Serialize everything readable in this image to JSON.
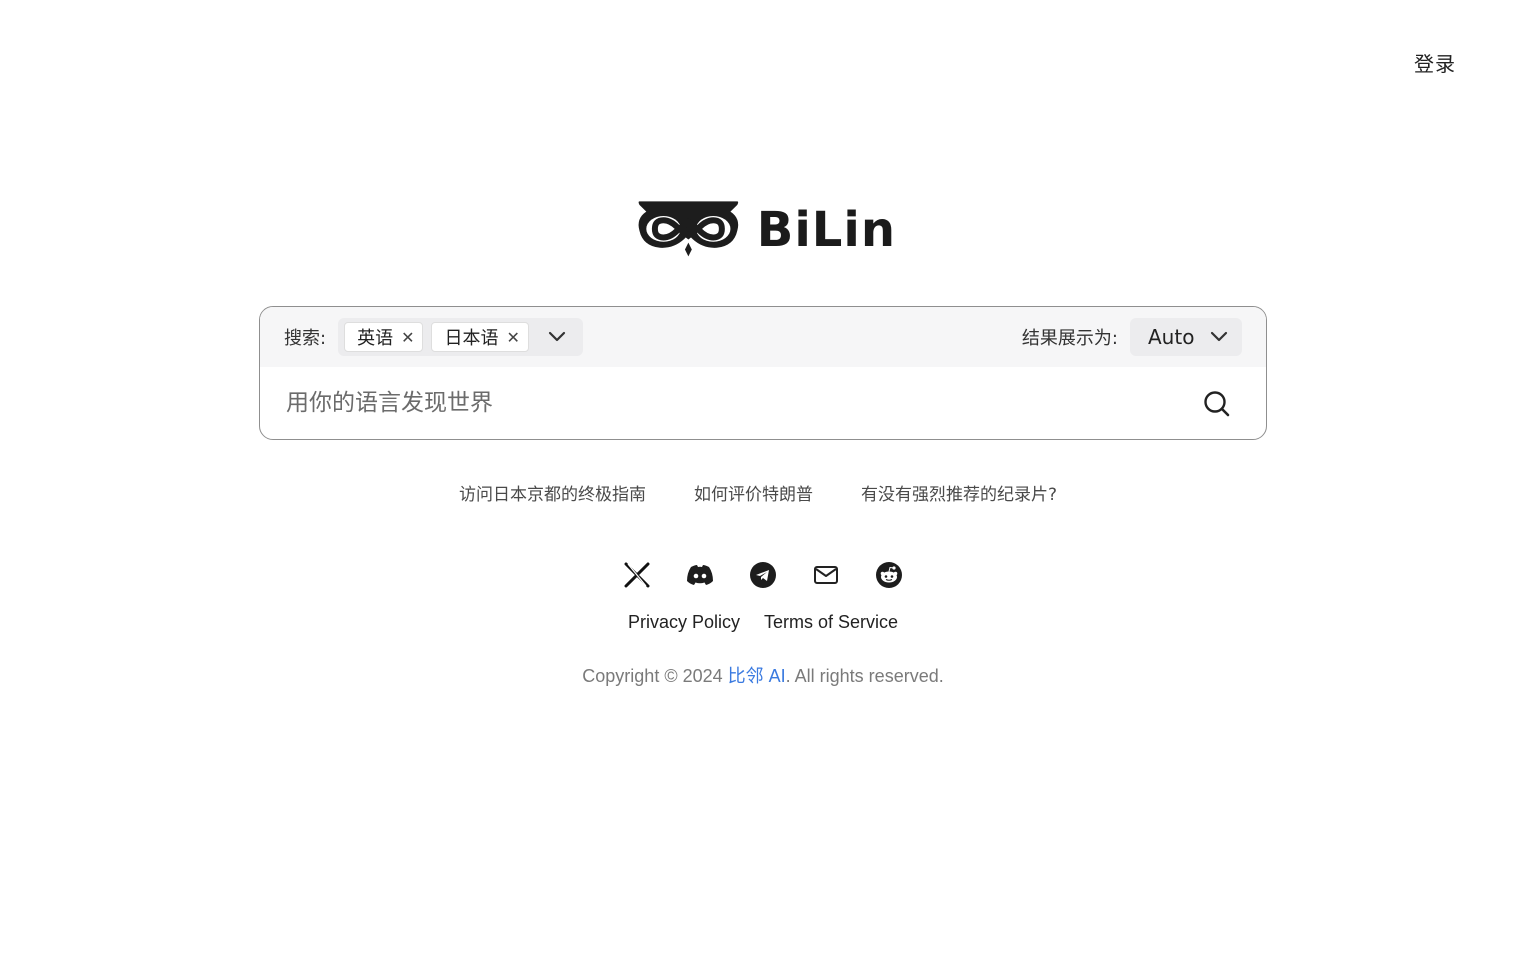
{
  "header": {
    "login_label": "登录"
  },
  "logo": {
    "text": "BiLin",
    "icon": "owl-infinity-logo"
  },
  "search": {
    "label": "搜索:",
    "languages": [
      {
        "label": "英语"
      },
      {
        "label": "日本语"
      }
    ],
    "display_label": "结果展示为:",
    "display_value": "Auto",
    "placeholder": "用你的语言发现世界",
    "value": ""
  },
  "suggestions": [
    "访问日本京都的终极指南",
    "如何评价特朗普",
    "有没有强烈推荐的纪录片?"
  ],
  "social": [
    "x-icon",
    "discord-icon",
    "telegram-icon",
    "mail-icon",
    "reddit-icon"
  ],
  "footer": {
    "privacy": "Privacy Policy",
    "terms": "Terms of Service",
    "copyright_prefix": "Copyright © 2024 ",
    "brand": "比邻 AI",
    "copyright_suffix": ". All rights reserved."
  },
  "colors": {
    "brand_link": "#3a7ae0",
    "border": "#8f8f8f",
    "top_bar": "#f6f6f7"
  }
}
